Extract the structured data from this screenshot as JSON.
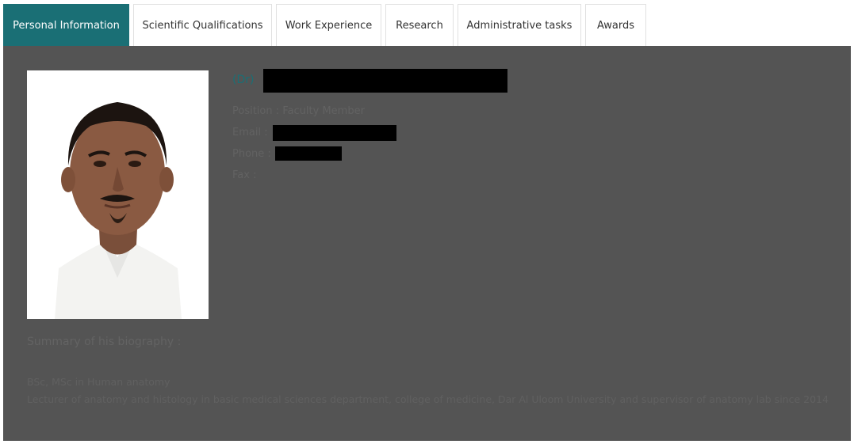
{
  "tabs": [
    {
      "label": "Personal Information",
      "active": true
    },
    {
      "label": "Scientific Qualifications",
      "active": false
    },
    {
      "label": "Work Experience",
      "active": false
    },
    {
      "label": "Research",
      "active": false
    },
    {
      "label": "Administrative tasks",
      "active": false
    },
    {
      "label": "Awards",
      "active": false
    }
  ],
  "profile": {
    "name_prefix": "(Dr)",
    "position_label": "Position :",
    "position_value": "Faculty Member",
    "email_label": "Email :",
    "phone_label": "Phone :",
    "fax_label": "Fax :"
  },
  "biography": {
    "title": "Summary of his biography :",
    "lines": [
      "BSc, MSc in Human anatomy",
      "Lecturer of anatomy and histology in basic medical sciences department, college of medicine, Dar Al Uloom University and supervisor of anatomy lab since 2014"
    ]
  },
  "colors": {
    "accent": "#1a6f75",
    "panel_bg": "#545454"
  }
}
